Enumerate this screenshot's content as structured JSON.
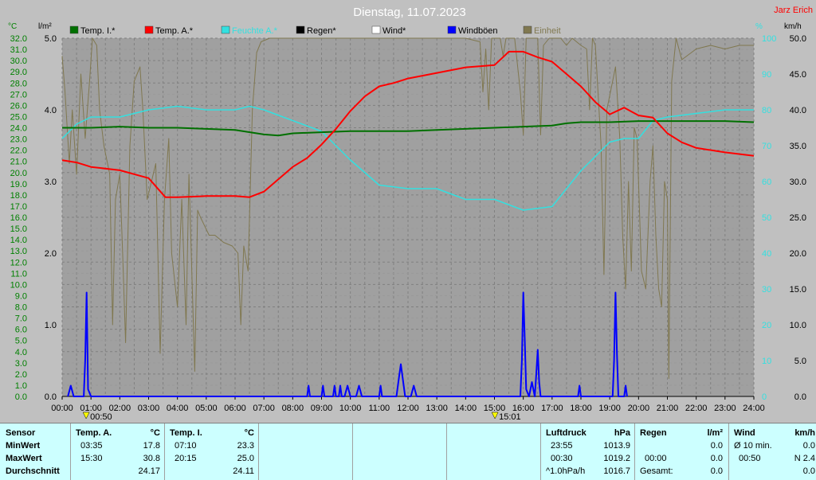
{
  "title": "Dienstag, 11.07.2023",
  "author": "Jarz Erich",
  "colors": {
    "bg": "#c0c0c0",
    "temp_i": "#007000",
    "temp_a": "#ff0000",
    "feuchte": "#33e0e0",
    "regen": "#000000",
    "wind": "#ffffff",
    "windboeen": "#0000ff",
    "einheit": "#807850"
  },
  "chart_data": {
    "type": "line",
    "title": "Dienstag, 11.07.2023",
    "x_ticks": [
      "00:00",
      "01:00",
      "02:00",
      "03:00",
      "04:00",
      "05:00",
      "06:00",
      "07:00",
      "08:00",
      "09:00",
      "10:00",
      "11:00",
      "12:00",
      "13:00",
      "14:00",
      "15:00",
      "16:00",
      "17:00",
      "18:00",
      "19:00",
      "20:00",
      "21:00",
      "22:00",
      "23:00",
      "24:00"
    ],
    "x_range": [
      0,
      24
    ],
    "left_axis_1": {
      "unit": "°C",
      "range": [
        0,
        32
      ],
      "ticks": [
        "0.0",
        "1.0",
        "2.0",
        "3.0",
        "4.0",
        "5.0",
        "6.0",
        "7.0",
        "8.0",
        "9.0",
        "10.0",
        "11.0",
        "12.0",
        "13.0",
        "14.0",
        "15.0",
        "16.0",
        "17.0",
        "18.0",
        "19.0",
        "20.0",
        "21.0",
        "22.0",
        "23.0",
        "24.0",
        "25.0",
        "26.0",
        "27.0",
        "28.0",
        "29.0",
        "30.0",
        "31.0",
        "32.0"
      ]
    },
    "left_axis_2": {
      "unit": "l/m²",
      "range": [
        0,
        5
      ],
      "ticks": [
        "0.0",
        "1.0",
        "2.0",
        "3.0",
        "4.0",
        "5.0"
      ]
    },
    "right_axis_1": {
      "unit": "%",
      "range": [
        0,
        100
      ],
      "ticks": [
        "0",
        "10",
        "20",
        "30",
        "40",
        "50",
        "60",
        "70",
        "80",
        "90",
        "100"
      ]
    },
    "right_axis_2": {
      "unit": "km/h",
      "range": [
        0,
        50
      ],
      "ticks": [
        "0.0",
        "5.0",
        "10.0",
        "15.0",
        "20.0",
        "25.0",
        "30.0",
        "35.0",
        "40.0",
        "45.0",
        "50.0"
      ]
    },
    "legend": [
      "Temp. I.*",
      "Temp. A.*",
      "Feuchte A.*",
      "Regen*",
      "Wind*",
      "Windböen",
      "Einheit"
    ],
    "markers": [
      {
        "x": 0.833,
        "label": "00:50"
      },
      {
        "x": 15.017,
        "label": "15:01"
      }
    ],
    "series": [
      {
        "name": "Temp. I.*",
        "axis": "left_axis_1",
        "points": [
          [
            0,
            24.0
          ],
          [
            1,
            24.0
          ],
          [
            2,
            24.1
          ],
          [
            3,
            24.0
          ],
          [
            4,
            24.0
          ],
          [
            5,
            23.9
          ],
          [
            6,
            23.8
          ],
          [
            7,
            23.4
          ],
          [
            7.5,
            23.3
          ],
          [
            8,
            23.5
          ],
          [
            9,
            23.6
          ],
          [
            10,
            23.7
          ],
          [
            11,
            23.7
          ],
          [
            12,
            23.7
          ],
          [
            13,
            23.8
          ],
          [
            14,
            23.9
          ],
          [
            15,
            24.0
          ],
          [
            16,
            24.1
          ],
          [
            17,
            24.2
          ],
          [
            17.5,
            24.4
          ],
          [
            18,
            24.5
          ],
          [
            19,
            24.5
          ],
          [
            20,
            24.6
          ],
          [
            21,
            24.6
          ],
          [
            22,
            24.6
          ],
          [
            23,
            24.6
          ],
          [
            24,
            24.5
          ]
        ]
      },
      {
        "name": "Temp. A.*",
        "axis": "left_axis_1",
        "points": [
          [
            0,
            21.1
          ],
          [
            0.5,
            20.9
          ],
          [
            1,
            20.5
          ],
          [
            2,
            20.2
          ],
          [
            3,
            19.5
          ],
          [
            3.58,
            17.8
          ],
          [
            4,
            17.8
          ],
          [
            5,
            17.9
          ],
          [
            6,
            17.9
          ],
          [
            6.5,
            17.8
          ],
          [
            7,
            18.3
          ],
          [
            8,
            20.5
          ],
          [
            8.5,
            21.3
          ],
          [
            9,
            22.5
          ],
          [
            9.5,
            23.9
          ],
          [
            10,
            25.5
          ],
          [
            10.5,
            26.8
          ],
          [
            11,
            27.7
          ],
          [
            11.5,
            28.0
          ],
          [
            12,
            28.4
          ],
          [
            13,
            28.9
          ],
          [
            14,
            29.4
          ],
          [
            15,
            29.6
          ],
          [
            15.5,
            30.8
          ],
          [
            16,
            30.8
          ],
          [
            16.5,
            30.3
          ],
          [
            17,
            29.9
          ],
          [
            17.5,
            28.8
          ],
          [
            18,
            27.7
          ],
          [
            18.5,
            26.3
          ],
          [
            19,
            25.2
          ],
          [
            19.5,
            25.8
          ],
          [
            20,
            25.1
          ],
          [
            20.5,
            24.9
          ],
          [
            21,
            23.5
          ],
          [
            21.5,
            22.7
          ],
          [
            22,
            22.2
          ],
          [
            23,
            21.8
          ],
          [
            24,
            21.5
          ]
        ]
      },
      {
        "name": "Feuchte A.*",
        "axis": "right_axis_1",
        "points": [
          [
            0,
            72
          ],
          [
            0.5,
            76
          ],
          [
            1,
            78
          ],
          [
            2,
            78
          ],
          [
            3,
            80
          ],
          [
            4,
            81
          ],
          [
            5,
            80
          ],
          [
            6,
            80
          ],
          [
            6.5,
            81
          ],
          [
            7,
            80
          ],
          [
            8,
            77
          ],
          [
            9,
            74
          ],
          [
            10,
            66
          ],
          [
            11,
            59
          ],
          [
            12,
            58
          ],
          [
            13,
            58
          ],
          [
            14,
            55
          ],
          [
            15,
            55
          ],
          [
            16,
            52
          ],
          [
            17,
            53
          ],
          [
            17.5,
            58
          ],
          [
            18,
            63
          ],
          [
            18.5,
            67
          ],
          [
            19,
            71
          ],
          [
            19.5,
            72
          ],
          [
            20,
            72
          ],
          [
            20.5,
            77
          ],
          [
            21,
            78
          ],
          [
            22,
            79
          ],
          [
            23,
            80
          ],
          [
            24,
            80
          ]
        ]
      },
      {
        "name": "Windböen",
        "axis": "right_axis_2",
        "points": [
          [
            0.2,
            0
          ],
          [
            0.3,
            1.5
          ],
          [
            0.4,
            0
          ],
          [
            0.75,
            0
          ],
          [
            0.8,
            5
          ],
          [
            0.85,
            14.5
          ],
          [
            0.9,
            1
          ],
          [
            1,
            0
          ],
          [
            8.5,
            0
          ],
          [
            8.55,
            1.5
          ],
          [
            8.6,
            0
          ],
          [
            9.0,
            0
          ],
          [
            9.05,
            1.5
          ],
          [
            9.1,
            0
          ],
          [
            9.4,
            0
          ],
          [
            9.45,
            1.5
          ],
          [
            9.5,
            0
          ],
          [
            9.6,
            0
          ],
          [
            9.65,
            1.5
          ],
          [
            9.7,
            0
          ],
          [
            9.8,
            0
          ],
          [
            9.9,
            1.5
          ],
          [
            10.0,
            0
          ],
          [
            10.2,
            0
          ],
          [
            10.3,
            1.5
          ],
          [
            10.4,
            0
          ],
          [
            11.0,
            0
          ],
          [
            11.05,
            1.5
          ],
          [
            11.1,
            0
          ],
          [
            11.6,
            0
          ],
          [
            11.7,
            3
          ],
          [
            11.75,
            4.5
          ],
          [
            11.8,
            3
          ],
          [
            11.9,
            0
          ],
          [
            12.1,
            0
          ],
          [
            12.2,
            1.5
          ],
          [
            12.3,
            0
          ],
          [
            15.9,
            0
          ],
          [
            15.95,
            5
          ],
          [
            16.0,
            14.5
          ],
          [
            16.05,
            8
          ],
          [
            16.1,
            1
          ],
          [
            16.2,
            0
          ],
          [
            16.3,
            2
          ],
          [
            16.4,
            0
          ],
          [
            16.45,
            3
          ],
          [
            16.5,
            6.5
          ],
          [
            16.55,
            2
          ],
          [
            16.6,
            0
          ],
          [
            17.9,
            0
          ],
          [
            17.95,
            1.5
          ],
          [
            18.0,
            0
          ],
          [
            19.1,
            0
          ],
          [
            19.15,
            5
          ],
          [
            19.2,
            14.5
          ],
          [
            19.25,
            6
          ],
          [
            19.3,
            0
          ],
          [
            19.5,
            0
          ],
          [
            19.55,
            1.5
          ],
          [
            19.6,
            0
          ]
        ]
      },
      {
        "name": "Einheit",
        "axis": "right_axis_1",
        "points": [
          [
            0,
            95
          ],
          [
            0.1,
            85
          ],
          [
            0.25,
            65
          ],
          [
            0.35,
            80
          ],
          [
            0.5,
            62
          ],
          [
            0.65,
            90
          ],
          [
            0.8,
            72
          ],
          [
            0.95,
            88
          ],
          [
            1.05,
            100
          ],
          [
            1.2,
            98
          ],
          [
            1.3,
            80
          ],
          [
            1.45,
            70
          ],
          [
            1.65,
            62
          ],
          [
            1.75,
            20
          ],
          [
            1.85,
            55
          ],
          [
            2.0,
            62
          ],
          [
            2.1,
            40
          ],
          [
            2.2,
            15
          ],
          [
            2.35,
            70
          ],
          [
            2.5,
            88
          ],
          [
            2.7,
            92
          ],
          [
            2.8,
            80
          ],
          [
            2.95,
            55
          ],
          [
            3.1,
            60
          ],
          [
            3.25,
            65
          ],
          [
            3.4,
            12
          ],
          [
            3.55,
            55
          ],
          [
            3.7,
            72
          ],
          [
            3.8,
            40
          ],
          [
            4.0,
            25
          ],
          [
            4.15,
            55
          ],
          [
            4.3,
            20
          ],
          [
            4.4,
            62
          ],
          [
            4.6,
            7
          ],
          [
            4.7,
            52
          ],
          [
            4.8,
            50
          ],
          [
            5.1,
            45
          ],
          [
            5.3,
            45
          ],
          [
            5.6,
            43
          ],
          [
            5.9,
            42
          ],
          [
            6.1,
            40
          ],
          [
            6.2,
            20
          ],
          [
            6.3,
            42
          ],
          [
            6.45,
            35
          ],
          [
            6.6,
            80
          ],
          [
            6.75,
            96
          ],
          [
            6.9,
            99
          ],
          [
            7.2,
            100
          ],
          [
            8,
            100
          ],
          [
            9,
            100
          ],
          [
            10,
            100
          ],
          [
            11,
            100
          ],
          [
            12,
            100
          ],
          [
            13,
            100
          ],
          [
            14,
            100
          ],
          [
            14.5,
            99
          ],
          [
            14.6,
            85
          ],
          [
            14.7,
            97
          ],
          [
            14.8,
            80
          ],
          [
            14.9,
            100
          ],
          [
            15.2,
            100
          ],
          [
            15.3,
            95
          ],
          [
            15.4,
            100
          ],
          [
            15.7,
            100
          ],
          [
            15.9,
            85
          ],
          [
            16.0,
            73
          ],
          [
            16.1,
            100
          ],
          [
            16.3,
            100
          ],
          [
            16.5,
            100
          ],
          [
            16.6,
            73
          ],
          [
            16.7,
            98
          ],
          [
            16.9,
            100
          ],
          [
            17.3,
            100
          ],
          [
            17.5,
            98
          ],
          [
            17.7,
            100
          ],
          [
            18.0,
            98
          ],
          [
            18.2,
            97
          ],
          [
            18.3,
            80
          ],
          [
            18.4,
            100
          ],
          [
            18.5,
            98
          ],
          [
            18.7,
            70
          ],
          [
            18.8,
            34
          ],
          [
            18.9,
            80
          ],
          [
            19.1,
            88
          ],
          [
            19.2,
            92
          ],
          [
            19.35,
            72
          ],
          [
            19.45,
            45
          ],
          [
            19.55,
            30
          ],
          [
            19.65,
            60
          ],
          [
            19.75,
            35
          ],
          [
            19.85,
            75
          ],
          [
            19.95,
            72
          ],
          [
            20.1,
            35
          ],
          [
            20.25,
            30
          ],
          [
            20.4,
            60
          ],
          [
            20.5,
            70
          ],
          [
            20.6,
            45
          ],
          [
            20.7,
            30
          ],
          [
            20.8,
            25
          ],
          [
            20.9,
            60
          ],
          [
            21.0,
            55
          ],
          [
            21.05,
            5
          ],
          [
            21.15,
            88
          ],
          [
            21.3,
            100
          ],
          [
            21.5,
            94
          ],
          [
            22,
            97
          ],
          [
            22.5,
            98
          ],
          [
            23,
            97
          ],
          [
            23.5,
            98
          ],
          [
            24,
            98
          ]
        ]
      }
    ]
  },
  "footer": {
    "sensor": {
      "h": "Sensor",
      "min": "MinWert",
      "max": "MaxWert",
      "avg": "Durchschnitt"
    },
    "temp_a": {
      "h": "Temp. A.",
      "u": "°C",
      "min_t": "03:35",
      "min_v": "17.8",
      "max_t": "15:30",
      "max_v": "30.8",
      "avg": "24.17"
    },
    "temp_i": {
      "h": "Temp. I.",
      "u": "°C",
      "min_t": "07:10",
      "min_v": "23.3",
      "max_t": "20:15",
      "max_v": "25.0",
      "avg": "24.11"
    },
    "luft": {
      "h": "Luftdruck",
      "u": "hPa",
      "min_t": "23:55",
      "min_v": "1013.9",
      "max_t": "00:30",
      "max_v": "1019.2",
      "trend_l": "^1.0hPa/h",
      "trend_v": "1016.7"
    },
    "regen": {
      "h": "Regen",
      "u": "l/m²",
      "r1_v": "0.0",
      "r2_t": "00:00",
      "r2_v": "0.0",
      "r3_l": "Gesamt:",
      "r3_v": "0.0"
    },
    "wind": {
      "h": "Wind",
      "u": "km/h",
      "r1_l": "Ø 10 min.",
      "r1_v": "0.0",
      "r2_t": "00:50",
      "r2_v": "N 2.4",
      "r3_v": "0.0"
    }
  }
}
